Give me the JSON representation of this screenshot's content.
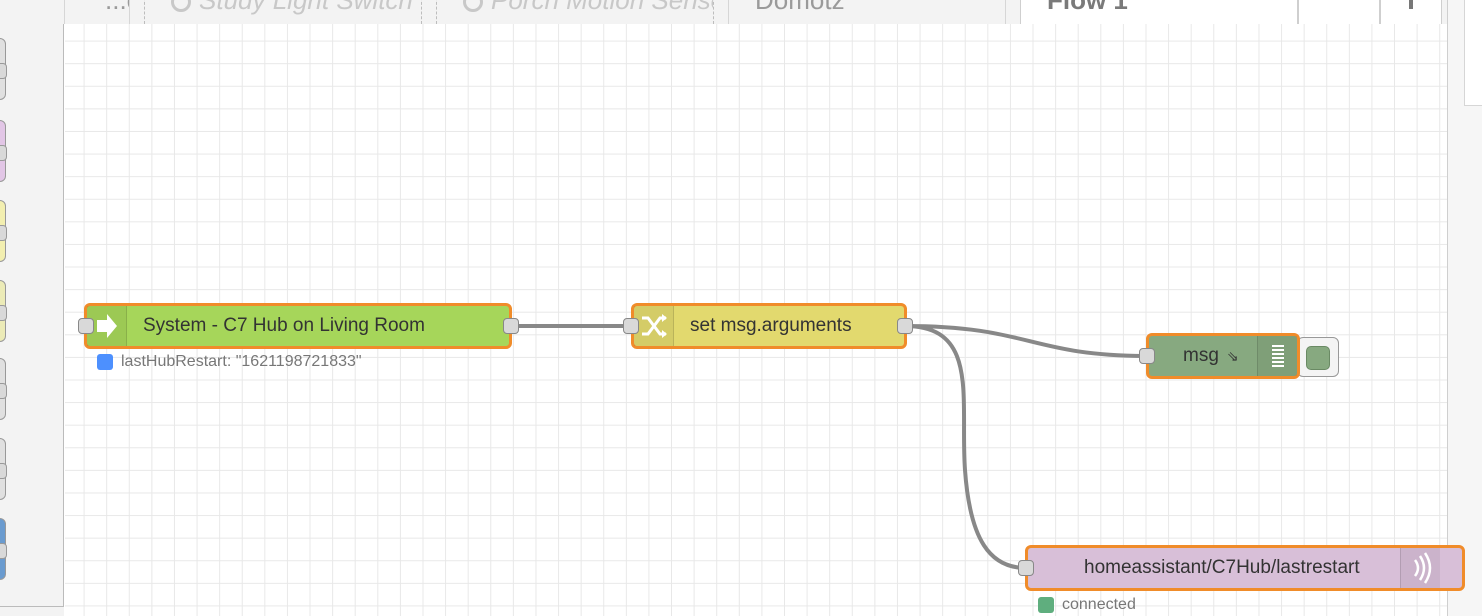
{
  "tabs": [
    {
      "label": "...on",
      "style": "plain"
    },
    {
      "label": "Study Light Switch",
      "style": "disabled"
    },
    {
      "label": "Porch Motion Sensor",
      "style": "disabled"
    },
    {
      "label": "Domotz",
      "style": "plain"
    },
    {
      "label": "Flow 1",
      "style": "active"
    }
  ],
  "colors": {
    "accent_border": "#f08c2a",
    "inject_node": "#a6d65a",
    "change_node": "#e2d96e",
    "debug_node": "#87a980",
    "mqtt_node": "#d8bfd8",
    "status_blue": "#4d90fe",
    "status_green": "#5fae7e",
    "wire": "#888888"
  },
  "nodes": {
    "inject": {
      "label": "System - C7 Hub on Living Room",
      "icon": "arrow-right-icon",
      "status": "lastHubRestart: \"1621198721833\""
    },
    "change": {
      "label": "set msg.arguments",
      "icon": "shuffle-icon"
    },
    "debug": {
      "label": "msg",
      "icon": "list-icon"
    },
    "mqtt_out": {
      "label": "homeassistant/C7Hub/lastrestart",
      "icon": "wifi-signal-icon",
      "status": "connected"
    }
  }
}
